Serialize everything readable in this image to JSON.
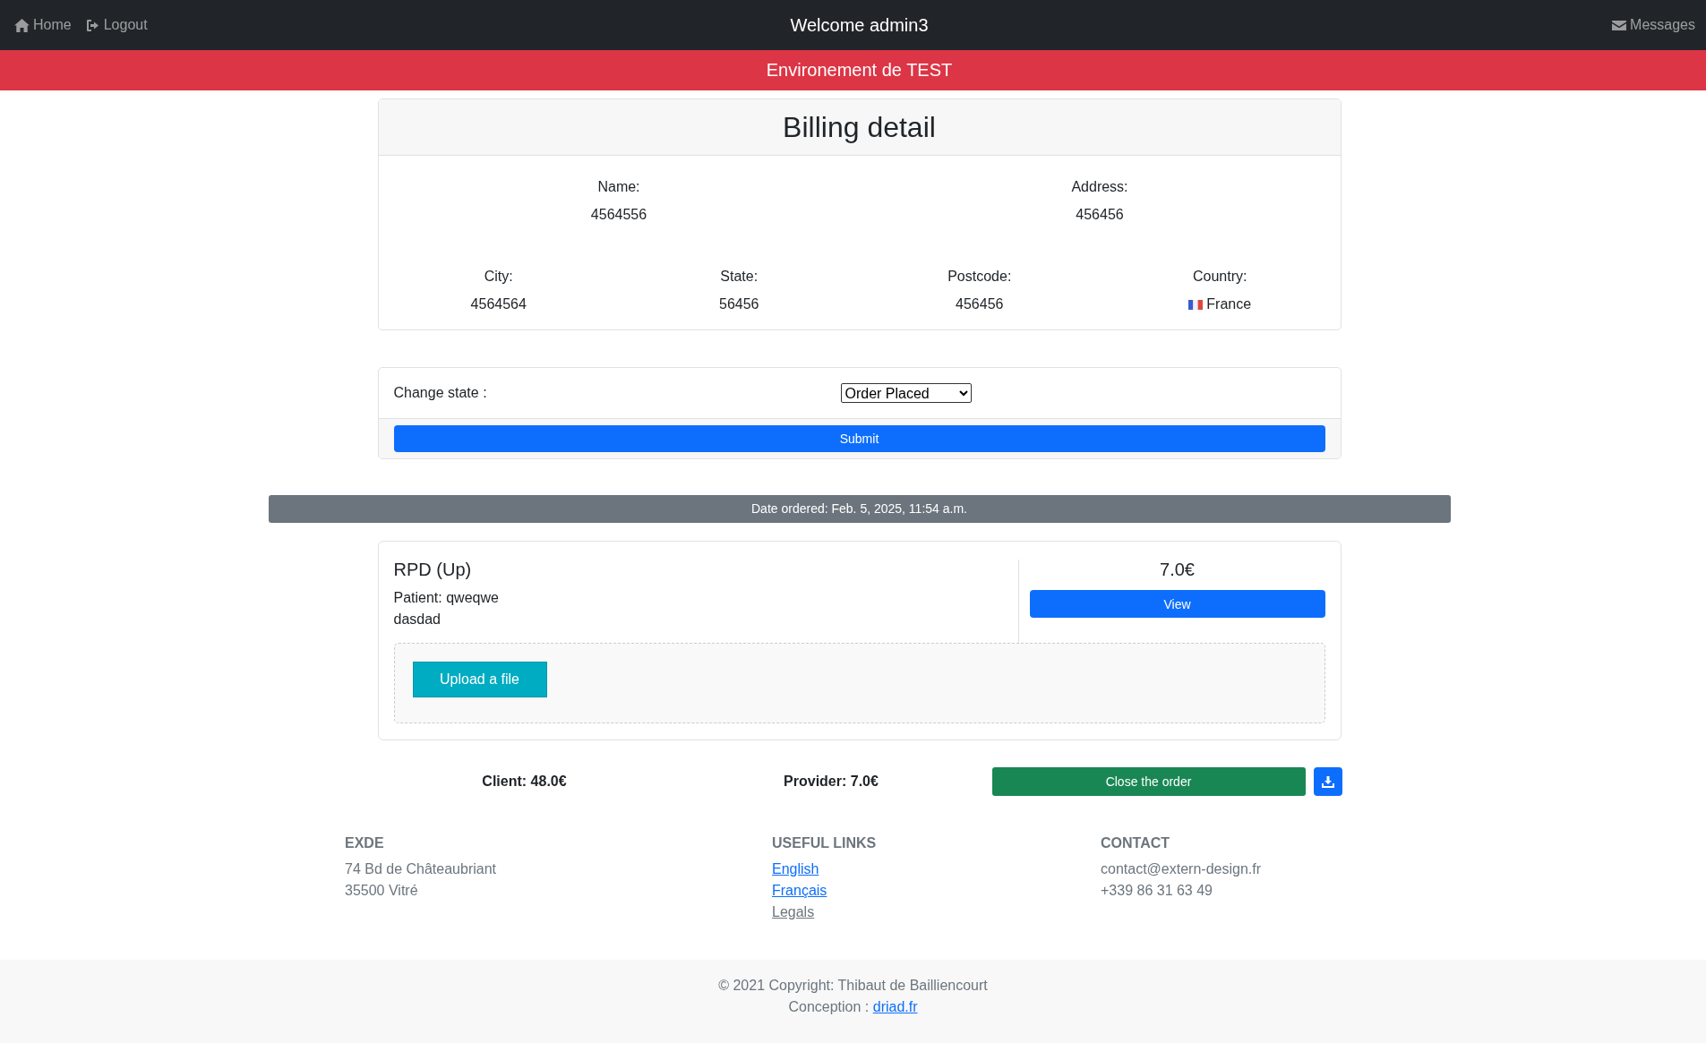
{
  "navbar": {
    "links": [
      {
        "label": "Home"
      },
      {
        "label": "Logout"
      }
    ],
    "title": "Welcome admin3",
    "messages": {
      "label": "Messages"
    }
  },
  "banner": "Environement de TEST",
  "billing": {
    "title": "Billing detail",
    "rows": [
      [
        {
          "label": "Name:",
          "value": "4564556"
        },
        {
          "label": "Address:",
          "value": "456456"
        }
      ],
      [
        {
          "label": "City:",
          "value": "4564564"
        },
        {
          "label": "State:",
          "value": "56456"
        },
        {
          "label": "Postcode:",
          "value": "456456"
        },
        {
          "label": "Country:",
          "value": "France",
          "flag": true
        }
      ]
    ]
  },
  "state_form": {
    "label": "Change state :",
    "select": {
      "value": "Order Placed"
    },
    "submit": "Submit"
  },
  "date_ordered": "Date ordered: Feb. 5, 2025, 11:54 a.m.",
  "items": [
    {
      "title": "RPD (Up)",
      "patient": "Patient: qweqwe",
      "note": "dasdad",
      "price": "7.0€",
      "view": "View",
      "upload": "Upload a file"
    }
  ],
  "totals": {
    "client": "Client: 48.0€",
    "provider": "Provider: 7.0€",
    "close": "Close the order"
  },
  "footer": {
    "columns": [
      {
        "heading": "EXDE",
        "lines": [
          {
            "kind": "text",
            "text": "74 Bd de Châteaubriant"
          },
          {
            "kind": "text",
            "text": "35500 Vitré"
          }
        ]
      },
      {
        "heading": "USEFUL LINKS",
        "lines": [
          {
            "kind": "link",
            "text": "English",
            "visited": false
          },
          {
            "kind": "link",
            "text": "Français",
            "visited": false
          },
          {
            "kind": "link",
            "text": "Legals",
            "visited": true
          }
        ]
      },
      {
        "heading": "CONTACT",
        "lines": [
          {
            "kind": "text",
            "text": "contact@extern-design.fr"
          },
          {
            "kind": "text",
            "text": "+339 86 31 63 49"
          }
        ]
      }
    ],
    "copyright": "© 2021 Copyright: Thibaut de Bailliencourt",
    "conception": {
      "label": "Conception :",
      "link": "driad.fr"
    }
  }
}
